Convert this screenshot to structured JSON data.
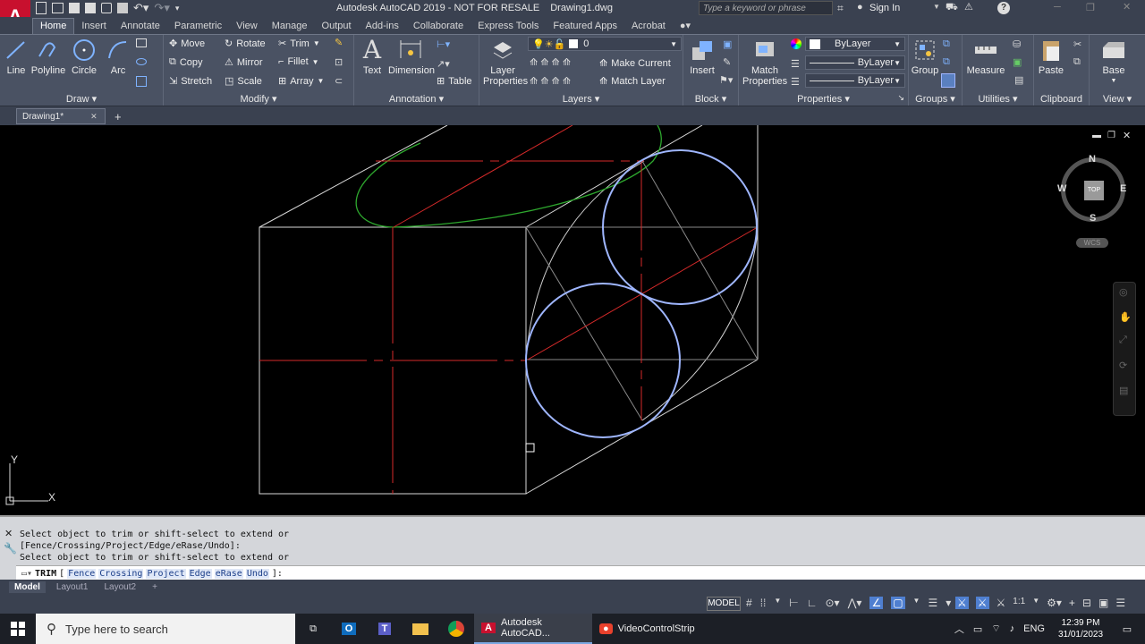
{
  "app": {
    "title": "Autodesk AutoCAD 2019 - NOT FOR RESALE",
    "file": "Drawing1.dwg",
    "search_placeholder": "Type a keyword or phrase",
    "sign_in": "Sign In"
  },
  "ribbon_tabs": [
    "Home",
    "Insert",
    "Annotate",
    "Parametric",
    "View",
    "Manage",
    "Output",
    "Add-ins",
    "Collaborate",
    "Express Tools",
    "Featured Apps",
    "Acrobat"
  ],
  "draw": {
    "title": "Draw",
    "line": "Line",
    "polyline": "Polyline",
    "circle": "Circle",
    "arc": "Arc"
  },
  "modify": {
    "title": "Modify",
    "move": "Move",
    "rotate": "Rotate",
    "trim": "Trim",
    "copy": "Copy",
    "mirror": "Mirror",
    "fillet": "Fillet",
    "stretch": "Stretch",
    "scale": "Scale",
    "array": "Array"
  },
  "annotation": {
    "title": "Annotation",
    "text": "Text",
    "dimension": "Dimension",
    "table": "Table"
  },
  "layers": {
    "title": "Layers",
    "layer_properties": "Layer Properties",
    "current_layer": "0",
    "make_current": "Make Current",
    "match_layer": "Match Layer"
  },
  "block": {
    "title": "Block",
    "insert": "Insert"
  },
  "properties": {
    "title": "Properties",
    "match_properties": "Match Properties",
    "color": "ByLayer",
    "linetype": "ByLayer",
    "lineweight": "ByLayer"
  },
  "groups": {
    "title": "Groups",
    "group": "Group"
  },
  "utilities": {
    "title": "Utilities",
    "measure": "Measure"
  },
  "clipboard": {
    "title": "Clipboard",
    "paste": "Paste"
  },
  "view": {
    "title": "View",
    "base": "Base"
  },
  "doc_tab": "Drawing1*",
  "viewcube": {
    "n": "N",
    "s": "S",
    "e": "E",
    "w": "W",
    "top": "TOP",
    "wcs": "WCS"
  },
  "ucs": {
    "x": "X",
    "y": "Y"
  },
  "command": {
    "history": [
      "Select object to trim or shift-select to extend or",
      "[Fence/Crossing/Project/Edge/eRase/Undo]:",
      "Select object to trim or shift-select to extend or"
    ],
    "prompt": "TRIM",
    "options": [
      "Fence",
      "Crossing",
      "Project",
      "Edge",
      "eRase",
      "Undo"
    ]
  },
  "layout_tabs": [
    "Model",
    "Layout1",
    "Layout2"
  ],
  "status": {
    "model": "MODEL",
    "scale": "1:1"
  },
  "taskbar": {
    "search": "Type here to search",
    "autocad": "Autodesk AutoCAD...",
    "video": "VideoControlStrip",
    "lang": "ENG",
    "time": "12:39 PM",
    "date": "31/01/2023"
  },
  "colors": {
    "ribbon": "#4a5263",
    "canvas": "#000000",
    "red": "#d62a2a",
    "green": "#2ea82e",
    "circle": "#9fb6ff"
  }
}
